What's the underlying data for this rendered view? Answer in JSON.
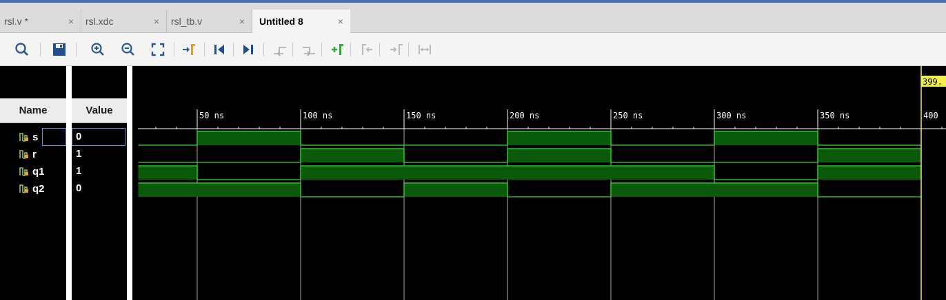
{
  "tabs": [
    {
      "label": "rsl.v *",
      "close": "×",
      "active": false
    },
    {
      "label": "rsl.xdc",
      "close": "×",
      "active": false
    },
    {
      "label": "rsl_tb.v",
      "close": "×",
      "active": false
    },
    {
      "label": "Untitled 8",
      "close": "×",
      "active": true
    }
  ],
  "toolbar": {
    "buttons": [
      {
        "name": "search-icon"
      },
      {
        "name": "save-icon"
      },
      {
        "name": "zoom-in-icon"
      },
      {
        "name": "zoom-out-icon"
      },
      {
        "name": "zoom-fit-icon"
      },
      {
        "name": "go-to-cursor-icon"
      },
      {
        "name": "go-to-time-0-icon"
      },
      {
        "name": "go-to-last-time-icon"
      },
      {
        "name": "previous-transition-icon"
      },
      {
        "name": "next-transition-icon"
      },
      {
        "name": "add-marker-icon"
      },
      {
        "name": "previous-marker-icon"
      },
      {
        "name": "next-marker-icon"
      },
      {
        "name": "swap-cursors-icon"
      }
    ]
  },
  "waveform": {
    "headers": {
      "name": "Name",
      "value": "Value"
    },
    "signals": [
      {
        "name": "s",
        "value": "0",
        "selected": true,
        "levels": [
          0,
          1,
          0,
          0,
          1,
          0,
          1,
          0,
          0
        ]
      },
      {
        "name": "r",
        "value": "1",
        "selected": false,
        "levels": [
          0,
          0,
          1,
          0,
          1,
          0,
          0,
          1,
          1
        ]
      },
      {
        "name": "q1",
        "value": "1",
        "selected": false,
        "levels": [
          1,
          0,
          1,
          1,
          1,
          1,
          0,
          1,
          1
        ]
      },
      {
        "name": "q2",
        "value": "0",
        "selected": false,
        "levels": [
          1,
          1,
          0,
          1,
          0,
          1,
          1,
          0,
          0
        ]
      }
    ],
    "time_axis": {
      "labels": [
        "50 ns",
        "100 ns",
        "150 ns",
        "200 ns",
        "250 ns",
        "300 ns",
        "350 ns",
        "400"
      ],
      "label_times_ns": [
        50,
        100,
        150,
        200,
        250,
        300,
        350,
        400
      ],
      "start_ns": 21.5,
      "segment_times_ns": [
        21.5,
        50,
        100,
        150,
        200,
        250,
        300,
        350,
        400
      ]
    },
    "cursor": {
      "label": "399.",
      "time_ns": 400
    }
  },
  "colors": {
    "wave_high_fill": "#0b5a0b",
    "wave_line": "#32e032",
    "cursor": "#f5ef4a",
    "gridline": "#c8c8c8",
    "selection_border": "#5a8ad8"
  }
}
